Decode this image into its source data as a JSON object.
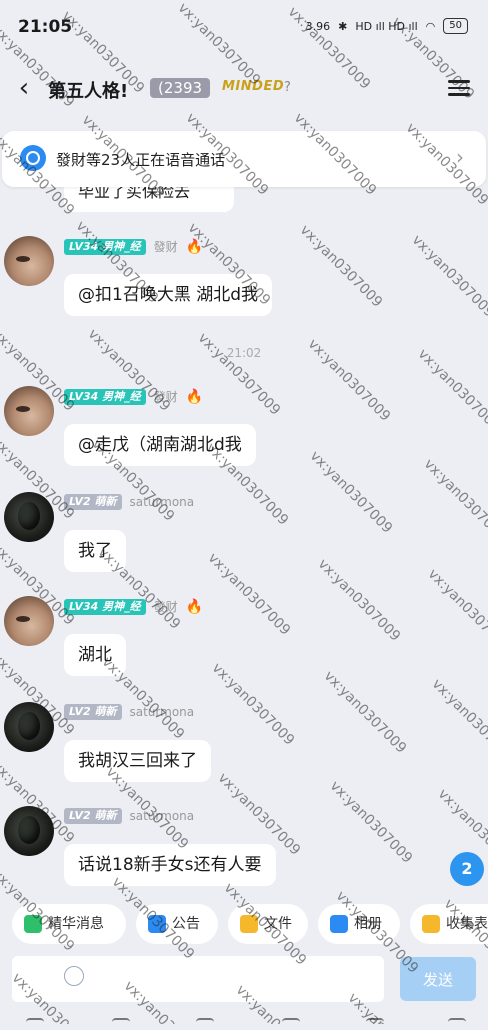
{
  "status_bar": {
    "time": "21:05",
    "speed": "3.96",
    "network": "HD ıll HD ıll",
    "battery": "50"
  },
  "header": {
    "title": "第五人格!",
    "member_count": "(2393",
    "minded": "MINDED"
  },
  "voice_banner": {
    "text": "發財等23人正在语音通话"
  },
  "partial_message": {
    "text": "毕业了买保险去"
  },
  "messages": [
    {
      "badge": "LV34 男神_经",
      "badge_color": "#27c4b7",
      "name": "發财",
      "fire": "🔥",
      "avatar": "face",
      "text": "@扣1召唤大黑 湖北d我"
    },
    {
      "badge": "LV34 男神_经",
      "badge_color": "#27c4b7",
      "name": "發财",
      "fire": "🔥",
      "avatar": "face",
      "text": "@走戊（湖南湖北d我"
    },
    {
      "badge": "LV2 萌新",
      "badge_color": "#b2b7c6",
      "name": "saturmona",
      "fire": "",
      "avatar": "dark",
      "text": "我了"
    },
    {
      "badge": "LV34 男神_经",
      "badge_color": "#27c4b7",
      "name": "發财",
      "fire": "🔥",
      "avatar": "face",
      "text": "湖北"
    },
    {
      "badge": "LV2 萌新",
      "badge_color": "#b2b7c6",
      "name": "saturmona",
      "fire": "",
      "avatar": "dark",
      "text": "我胡汉三回来了"
    },
    {
      "badge": "LV2 萌新",
      "badge_color": "#b2b7c6",
      "name": "saturmona",
      "fire": "",
      "avatar": "dark",
      "text": "话说18新手女s还有人要"
    }
  ],
  "timestamp": "21:02",
  "unread_count": "2",
  "quick_bar": {
    "items": [
      {
        "label": "精华消息",
        "icon_color": "#2fbf6a"
      },
      {
        "label": "公告",
        "icon_color": "#2b8bf2"
      },
      {
        "label": "文件",
        "icon_color": "#f5b82a"
      },
      {
        "label": "相册",
        "icon_color": "#2b8bf2"
      },
      {
        "label": "收集表",
        "icon_color": "#f5b82a"
      }
    ]
  },
  "input": {
    "placeholder": "",
    "send_label": "发送"
  },
  "watermark": "vx:yan0307009"
}
